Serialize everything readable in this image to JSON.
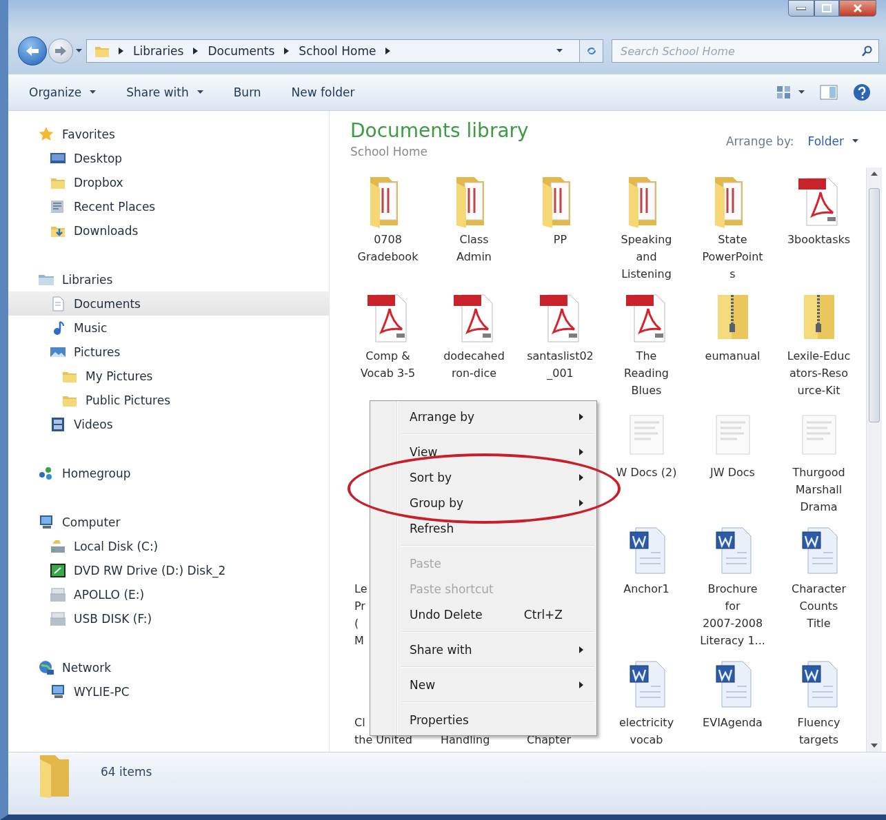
{
  "nav": {
    "breadcrumb": [
      "Libraries",
      "Documents",
      "School Home"
    ],
    "search": {
      "placeholder": "Search School Home"
    }
  },
  "toolbar": {
    "buttons": [
      {
        "label": "Organize",
        "dropdown": true
      },
      {
        "label": "Share with",
        "dropdown": true
      },
      {
        "label": "Burn",
        "dropdown": false
      },
      {
        "label": "New folder",
        "dropdown": false
      }
    ]
  },
  "sidebar": {
    "groups": [
      {
        "label": "Favorites",
        "kind": "star",
        "selected": false,
        "children": [
          {
            "label": "Desktop",
            "kind": "desktop",
            "selected": false
          },
          {
            "label": "Dropbox",
            "kind": "folder",
            "selected": false
          },
          {
            "label": "Recent Places",
            "kind": "places",
            "selected": false
          },
          {
            "label": "Downloads",
            "kind": "downloads",
            "selected": false
          }
        ]
      },
      {
        "label": "Libraries",
        "kind": "library",
        "selected": false,
        "children": [
          {
            "label": "Documents",
            "kind": "document",
            "selected": true
          },
          {
            "label": "Music",
            "kind": "music",
            "selected": false
          },
          {
            "label": "Pictures",
            "kind": "pictures",
            "selected": false,
            "children": [
              {
                "label": "My Pictures",
                "kind": "folder",
                "selected": false
              },
              {
                "label": "Public Pictures",
                "kind": "folder",
                "selected": false
              }
            ]
          },
          {
            "label": "Videos",
            "kind": "videos",
            "selected": false
          }
        ]
      },
      {
        "label": "Homegroup",
        "kind": "homegroup",
        "selected": false
      },
      {
        "label": "Computer",
        "kind": "computer",
        "selected": false,
        "children": [
          {
            "label": "Local Disk (C:)",
            "kind": "disk",
            "selected": false
          },
          {
            "label": "DVD RW Drive (D:) Disk_2",
            "kind": "dvd",
            "selected": false
          },
          {
            "label": "APOLLO (E:)",
            "kind": "drive",
            "selected": false
          },
          {
            "label": "USB DISK (F:)",
            "kind": "drive",
            "selected": false
          }
        ]
      },
      {
        "label": "Network",
        "kind": "network",
        "selected": false,
        "children": [
          {
            "label": "WYLIE-PC",
            "kind": "computer",
            "selected": false
          }
        ]
      }
    ]
  },
  "library": {
    "title": "Documents library",
    "subtitle": "School Home",
    "arrange_label": "Arrange by:",
    "arrange_value": "Folder"
  },
  "files": [
    {
      "kind": "folder",
      "label": "0708\nGradebook"
    },
    {
      "kind": "folder",
      "label": "Class\nAdmin"
    },
    {
      "kind": "folder",
      "label": "PP"
    },
    {
      "kind": "folder",
      "label": "Speaking\nand\nListening"
    },
    {
      "kind": "folder",
      "label": "State\nPowerPoint\ns"
    },
    {
      "kind": "pdf",
      "label": "3booktasks"
    },
    {
      "kind": "pdf",
      "label": "Comp &\nVocab 3-5"
    },
    {
      "kind": "pdf",
      "label": "dodecahed\nron-dice"
    },
    {
      "kind": "pdf",
      "label": "santaslist02\n_001"
    },
    {
      "kind": "pdf",
      "label": "The\nReading\nBlues"
    },
    {
      "kind": "zip",
      "label": "eumanual"
    },
    {
      "kind": "zip",
      "label": "Lexile-Educ\nators-Reso\nurce-Kit"
    },
    {
      "kind": "covered"
    },
    {
      "kind": "covered"
    },
    {
      "kind": "covered"
    },
    {
      "kind": "page",
      "label": "W Docs (2)"
    },
    {
      "kind": "page",
      "label": "JW Docs"
    },
    {
      "kind": "page",
      "label": "Thurgood\nMarshall\nDrama"
    },
    {
      "kind": "covered",
      "label": "Le\nPr\n(\nM"
    },
    {
      "kind": "covered"
    },
    {
      "kind": "covered"
    },
    {
      "kind": "word",
      "label": "Anchor1"
    },
    {
      "kind": "word",
      "label": "Brochure\nfor\n2007-2008\nLiteracy 1..."
    },
    {
      "kind": "word",
      "label": "Character\nCounts\nTitle"
    },
    {
      "kind": "covered",
      "label": "Cl\nthe United"
    },
    {
      "kind": "covered",
      "label": "Handling"
    },
    {
      "kind": "covered",
      "label": "Chapter"
    },
    {
      "kind": "word",
      "label": "electricity\nvocab"
    },
    {
      "kind": "word",
      "label": "EVIAgenda"
    },
    {
      "kind": "word",
      "label": "Fluency\ntargets"
    }
  ],
  "context_menu": {
    "items": [
      {
        "kind": "item",
        "label": "Arrange by",
        "submenu": true,
        "disabled": false,
        "circled": false
      },
      {
        "kind": "separator"
      },
      {
        "kind": "item",
        "label": "View",
        "submenu": true,
        "disabled": false,
        "circled": false
      },
      {
        "kind": "item",
        "label": "Sort by",
        "submenu": true,
        "disabled": false,
        "circled": true
      },
      {
        "kind": "item",
        "label": "Group by",
        "submenu": true,
        "disabled": false,
        "circled": true
      },
      {
        "kind": "item",
        "label": "Refresh",
        "submenu": false,
        "disabled": false,
        "circled": false
      },
      {
        "kind": "separator"
      },
      {
        "kind": "item",
        "label": "Paste",
        "submenu": false,
        "disabled": true,
        "circled": false
      },
      {
        "kind": "item",
        "label": "Paste shortcut",
        "submenu": false,
        "disabled": true,
        "circled": false
      },
      {
        "kind": "item",
        "label": "Undo Delete",
        "shortcut": "Ctrl+Z",
        "submenu": false,
        "disabled": false,
        "circled": false
      },
      {
        "kind": "separator"
      },
      {
        "kind": "item",
        "label": "Share with",
        "submenu": true,
        "disabled": false,
        "circled": false
      },
      {
        "kind": "separator"
      },
      {
        "kind": "item",
        "label": "New",
        "submenu": true,
        "disabled": false,
        "circled": false
      },
      {
        "kind": "separator"
      },
      {
        "kind": "item",
        "label": "Properties",
        "submenu": false,
        "disabled": false,
        "circled": false
      }
    ]
  },
  "status_bar": {
    "count": "64 items"
  }
}
